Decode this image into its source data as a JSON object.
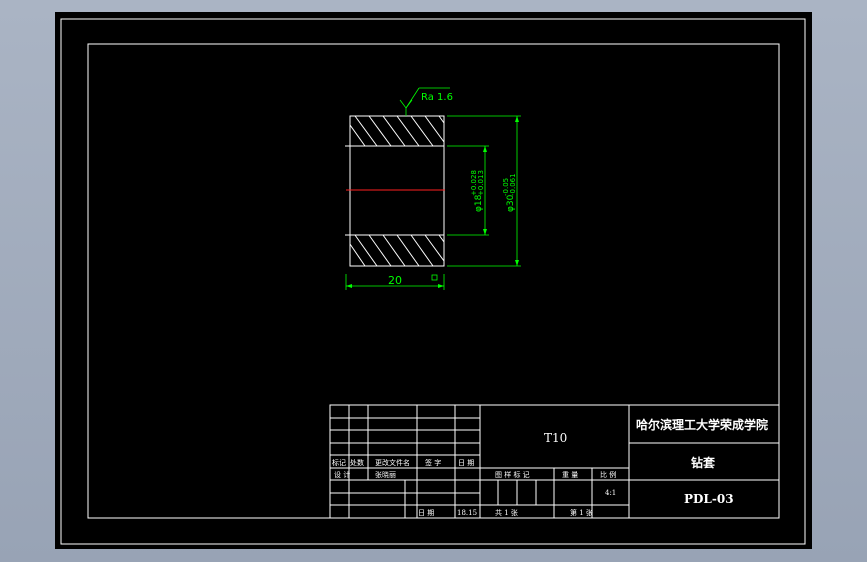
{
  "drawing": {
    "roughness": "Ra 1.6",
    "dim_length": "20",
    "dim_inner": "φ18",
    "dim_inner_tol_upper": "+0.028",
    "dim_inner_tol_lower": "+0.013",
    "dim_outer": "φ30",
    "dim_outer_tol_upper": "-0.05",
    "dim_outer_tol_lower": "-0.061"
  },
  "title_block": {
    "material": "T10",
    "school": "哈尔滨理工大学荣成学院",
    "part_name": "钻套",
    "drawing_no": "PDL-03",
    "scale": "4:1",
    "hdr_mark": "标记",
    "hdr_count": "处数",
    "hdr_file": "更改文件名",
    "hdr_sign": "签 字",
    "hdr_date": "日 期",
    "hdr_design": "设 计",
    "designer": "张晓丽",
    "hdr_date2": "日 期",
    "date_value": "18.15",
    "hdr_drawing_mark": "图 样 标 记",
    "hdr_weight": "重 量",
    "hdr_scale": "比 例",
    "sheets_total": "共 1 张",
    "sheet_no": "第 1 张"
  }
}
